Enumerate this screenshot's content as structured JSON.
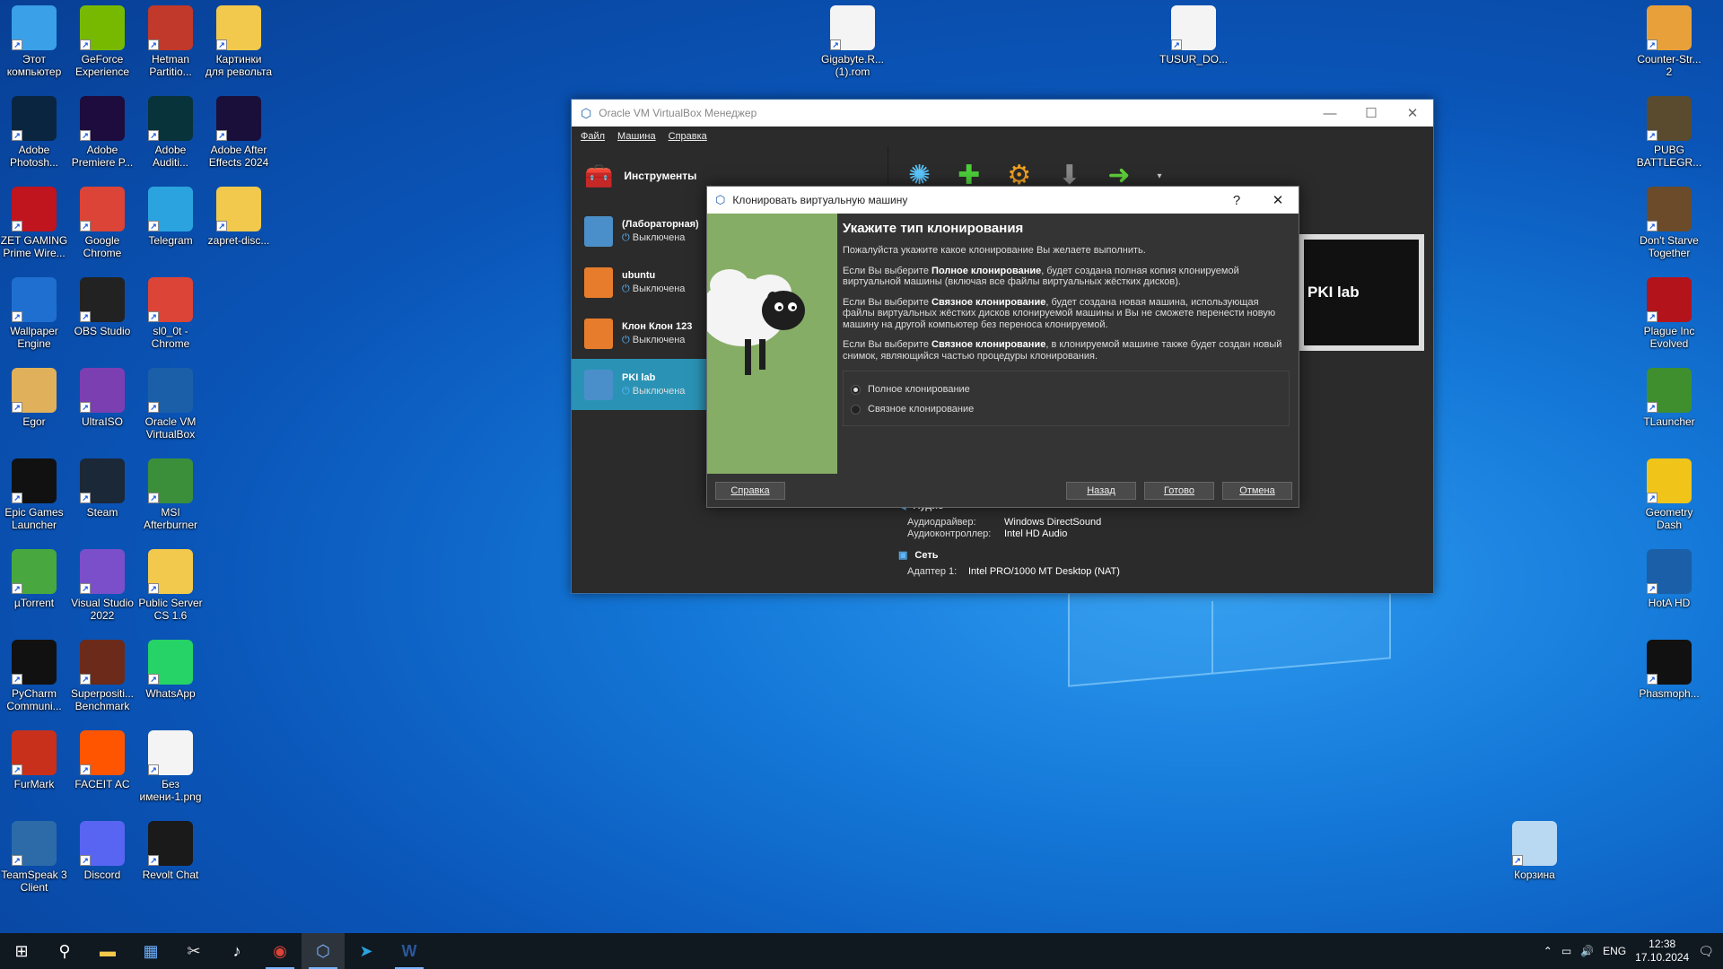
{
  "desktop_left": [
    {
      "label": "Этот\nкомпьютер",
      "icon": "computer-icon",
      "color": "#3aa0e8"
    },
    {
      "label": "GeForce\nExperience",
      "icon": "nvidia-icon",
      "color": "#76b900"
    },
    {
      "label": "Hetman\nPartitio...",
      "icon": "hetman-icon",
      "color": "#c0392b"
    },
    {
      "label": "Картинки\nдля револьта",
      "icon": "folder-icon",
      "color": "#f2c94c"
    },
    {
      "label": "Adobe\nPhotosh...",
      "icon": "photoshop-icon",
      "color": "#0a2540"
    },
    {
      "label": "Adobe\nPremiere P...",
      "icon": "premiere-icon",
      "color": "#1d0c3d"
    },
    {
      "label": "Adobe\nAuditi...",
      "icon": "audition-icon",
      "color": "#08333a"
    },
    {
      "label": "Adobe After\nEffects 2024",
      "icon": "aftereffects-icon",
      "color": "#1a0f3b"
    },
    {
      "label": "ZET GAMING\nPrime Wire...",
      "icon": "zet-icon",
      "color": "#c0141e"
    },
    {
      "label": "Google\nChrome",
      "icon": "chrome-icon",
      "color": "#db4437"
    },
    {
      "label": "Telegram",
      "icon": "telegram-icon",
      "color": "#2aa3de"
    },
    {
      "label": "zapret-disc...",
      "icon": "folder-icon",
      "color": "#f2c94c"
    },
    {
      "label": "Wallpaper\nEngine",
      "icon": "wallpaper-icon",
      "color": "#1f6fd1"
    },
    {
      "label": "OBS Studio",
      "icon": "obs-icon",
      "color": "#222"
    },
    {
      "label": "sl0_0t -\nChrome",
      "icon": "chrome-profile-icon",
      "color": "#db4437"
    },
    {
      "label": "Egor",
      "icon": "folder-icon",
      "color": "#e0b15a"
    },
    {
      "label": "UltraISO",
      "icon": "ultraiso-icon",
      "color": "#7b3fb2"
    },
    {
      "label": "Oracle VM\nVirtualBox",
      "icon": "virtualbox-icon",
      "color": "#1b5fa8"
    },
    {
      "label": "Epic Games\nLauncher",
      "icon": "epic-icon",
      "color": "#111"
    },
    {
      "label": "Steam",
      "icon": "steam-icon",
      "color": "#1b2838"
    },
    {
      "label": "MSI\nAfterburner",
      "icon": "afterburner-icon",
      "color": "#3b8f3b"
    },
    {
      "label": "µTorrent",
      "icon": "utorrent-icon",
      "color": "#48a83f"
    },
    {
      "label": "Visual Studio\n2022",
      "icon": "visualstudio-icon",
      "color": "#7b4fc9"
    },
    {
      "label": "Public Server\nCS 1.6",
      "icon": "folder-icon",
      "color": "#f2c94c"
    },
    {
      "label": "PyCharm\nCommuni...",
      "icon": "pycharm-icon",
      "color": "#111"
    },
    {
      "label": "Superpositi...\nBenchmark",
      "icon": "superposition-icon",
      "color": "#6b2a1a"
    },
    {
      "label": "WhatsApp",
      "icon": "whatsapp-icon",
      "color": "#25d366"
    },
    {
      "label": "FurMark",
      "icon": "furmark-icon",
      "color": "#c9301c"
    },
    {
      "label": "FACEIT AC",
      "icon": "faceit-icon",
      "color": "#ff5500"
    },
    {
      "label": "Без\nимени-1.png",
      "icon": "image-file-icon",
      "color": "#f4f4f4"
    },
    {
      "label": "TeamSpeak 3\nClient",
      "icon": "teamspeak-icon",
      "color": "#2d6ba8"
    },
    {
      "label": "Discord",
      "icon": "discord-icon",
      "color": "#5865f2"
    },
    {
      "label": "Revolt Chat",
      "icon": "revolt-icon",
      "color": "#1a1a1a"
    }
  ],
  "desktop_top": [
    {
      "label": "Gigabyte.R...\n(1).rom",
      "icon": "file-icon",
      "color": "#f4f4f4"
    },
    {
      "label": "TUSUR_DO...",
      "icon": "json-file-icon",
      "color": "#f4f4f4"
    }
  ],
  "desktop_right": [
    {
      "label": "Counter-Str...\n2",
      "icon": "cs2-icon",
      "color": "#e8a13a"
    },
    {
      "label": "PUBG\nBATTLEGR...",
      "icon": "pubg-icon",
      "color": "#5a4b2e"
    },
    {
      "label": "Don't Starve\nTogether",
      "icon": "dontstarve-icon",
      "color": "#6b4b2a"
    },
    {
      "label": "Plague Inc\nEvolved",
      "icon": "plague-icon",
      "color": "#b3131b"
    },
    {
      "label": "TLauncher",
      "icon": "minecraft-icon",
      "color": "#3f8f2f"
    },
    {
      "label": "Geometry\nDash",
      "icon": "geometrydash-icon",
      "color": "#f0c419"
    },
    {
      "label": "HotA HD",
      "icon": "hota-icon",
      "color": "#1a5fa8"
    },
    {
      "label": "Phasmoph...",
      "icon": "phasmophobia-icon",
      "color": "#111"
    },
    {
      "label": "Корзина",
      "icon": "recycle-bin-icon",
      "color": "#b9d8f2"
    }
  ],
  "vbox": {
    "title": "Oracle VM VirtualBox Менеджер",
    "menu": [
      "Файл",
      "Машина",
      "Справка"
    ],
    "tools_label": "Инструменты",
    "vms": [
      {
        "name": "(Лабораторная)",
        "state": "Выключена",
        "os": "10"
      },
      {
        "name": "ubuntu",
        "state": "Выключена",
        "os": ""
      },
      {
        "name": "Клон Клон 123",
        "state": "Выключена",
        "os": ""
      },
      {
        "name": "PKI lab",
        "state": "Выключена",
        "os": "2019"
      }
    ],
    "preview_text": "PKI lab",
    "audio": {
      "title": "Аудио",
      "driver_k": "Аудиодрайвер:",
      "driver_v": "Windows DirectSound",
      "ctrl_k": "Аудиоконтроллер:",
      "ctrl_v": "Intel HD Audio"
    },
    "network": {
      "title": "Сеть",
      "adapter_k": "Адаптер 1:",
      "adapter_v": "Intel PRO/1000 MT Desktop (NAT)"
    }
  },
  "dialog": {
    "title": "Клонировать виртуальную машину",
    "help_glyph": "?",
    "heading": "Укажите тип клонирования",
    "intro": "Пожалуйста укажите какое клонирование Вы желаете выполнить.",
    "p1_a": "Если Вы выберите ",
    "p1_b": "Полное клонирование",
    "p1_c": ", будет создана полная копия клонируемой виртуальной машины (включая все файлы виртуальных жёстких дисков).",
    "p2_a": "Если Вы выберите ",
    "p2_b": "Связное клонирование",
    "p2_c": ", будет создана новая машина, использующая файлы виртуальных жёстких дисков клонируемой машины и Вы не сможете перенести новую машину на другой компьютер без переноса клонируемой.",
    "p3_a": "Если Вы выберите ",
    "p3_b": "Связное клонирование",
    "p3_c": ", в клонируемой машине также будет создан новый снимок, являющийся частью процедуры клонирования.",
    "option_full": "Полное клонирование",
    "option_linked": "Связное клонирование",
    "selected": "full",
    "btn_help": "Справка",
    "btn_back": "Назад",
    "btn_finish": "Готово",
    "btn_cancel": "Отмена"
  },
  "taskbar": {
    "lang": "ENG",
    "time": "12:38",
    "date": "17.10.2024"
  }
}
